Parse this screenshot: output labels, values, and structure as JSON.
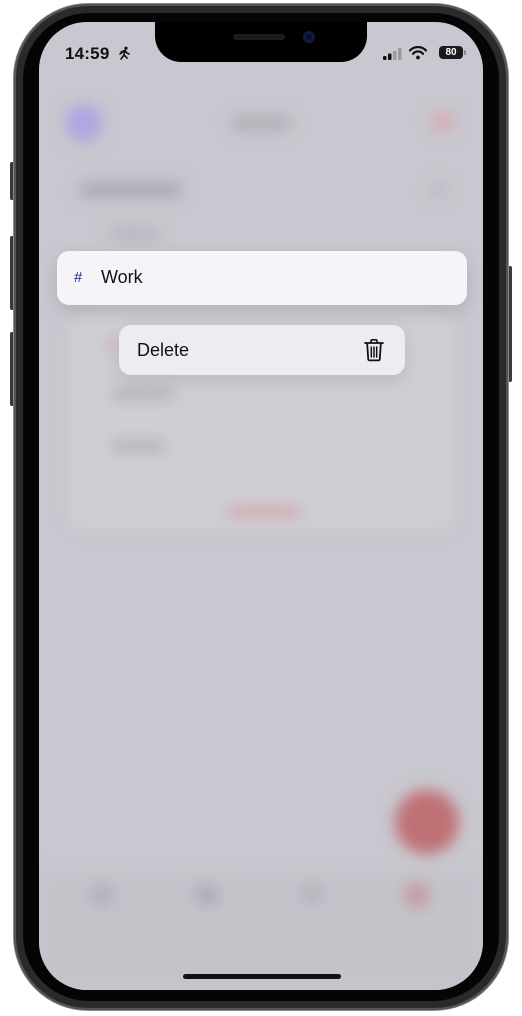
{
  "status_bar": {
    "time": "14:59",
    "battery": "80"
  },
  "focused_item": {
    "hash": "#",
    "label": "Work"
  },
  "context_menu": {
    "delete_label": "Delete",
    "delete_icon": "trash-icon"
  },
  "colors": {
    "hash": "#1b2a8a",
    "accent": "#c0494b"
  }
}
